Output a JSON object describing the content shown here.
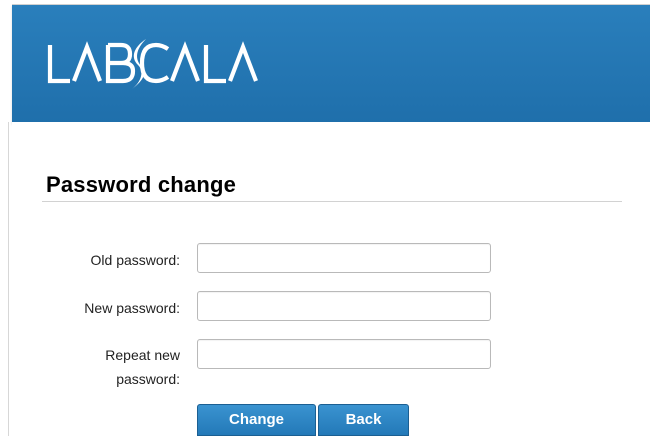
{
  "brand": {
    "logo_text": "LABSCALA",
    "header_color": "#1f6fab"
  },
  "form": {
    "title": "Password change",
    "old_password_label": "Old password:",
    "old_password_value": "",
    "new_password_label": "New password:",
    "new_password_value": "",
    "repeat_password_label_line1": "Repeat new",
    "repeat_password_label_line2": "password:",
    "repeat_password_value": ""
  },
  "buttons": {
    "change_label": "Change",
    "back_label": "Back",
    "button_color": "#2a86c6"
  }
}
